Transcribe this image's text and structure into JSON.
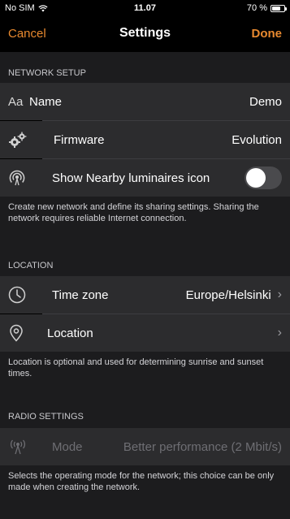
{
  "status": {
    "carrier": "No SIM",
    "time": "11.07",
    "battery": "70 %",
    "battery_level": 0.7
  },
  "nav": {
    "cancel": "Cancel",
    "title": "Settings",
    "done": "Done"
  },
  "network_setup": {
    "header": "NETWORK SETUP",
    "name": {
      "icon_text": "Aa",
      "label": "Name",
      "value": "Demo"
    },
    "firmware": {
      "label": "Firmware",
      "value": "Evolution"
    },
    "nearby": {
      "label": "Show Nearby luminaires icon",
      "toggle_on": false
    },
    "note": "Create new network and define its sharing settings. Sharing the network requires reliable Internet connection."
  },
  "location": {
    "header": "LOCATION",
    "timezone": {
      "label": "Time zone",
      "value": "Europe/Helsinki"
    },
    "location": {
      "label": "Location",
      "value": ""
    },
    "note": "Location is optional and used for determining sunrise and sunset times."
  },
  "radio": {
    "header": "RADIO SETTINGS",
    "mode": {
      "label": "Mode",
      "value": "Better performance (2 Mbit/s)"
    },
    "note": "Selects the operating mode for the network; this choice can be only made when creating the network."
  },
  "colors": {
    "accent": "#e8892f",
    "cell": "#2c2c2e",
    "grouped_bg": "#1c1c1e"
  }
}
